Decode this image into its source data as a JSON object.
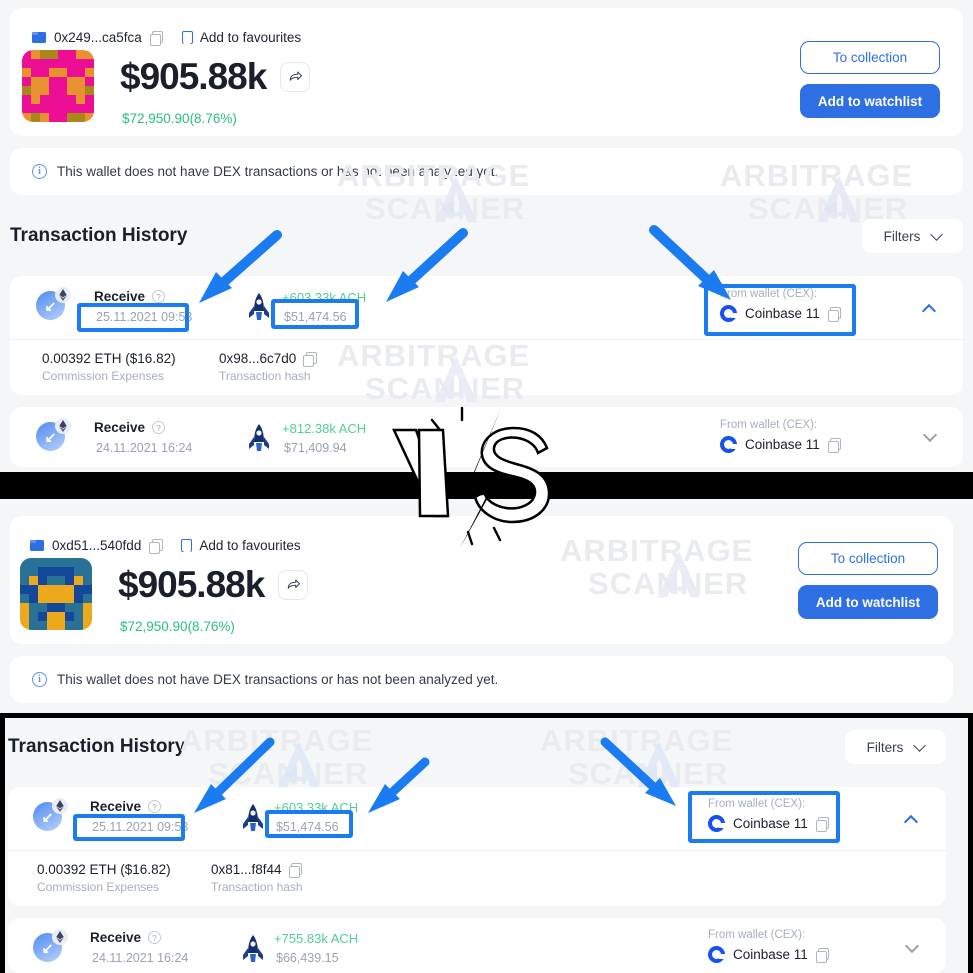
{
  "watermark": {
    "line1": "ARBITRAGE",
    "line2": "SCANNER"
  },
  "panels": [
    {
      "id": "top",
      "address": "0x249...ca5fca",
      "favourites_label": "Add to favourites",
      "balance": "$905.88k",
      "delta": "$72,950.90(8.76%)",
      "to_collection_label": "To collection",
      "watchlist_label": "Add to watchlist",
      "info_text": "This wallet does not have DEX transactions or has not been analyzed yet.",
      "section_title": "Transaction History",
      "filters_label": "Filters",
      "avatar_colors": {
        "bg": "#ec0f96",
        "a": "#e8922f",
        "b": "#a8881a"
      },
      "transactions": [
        {
          "type": "Receive",
          "date": "25.11.2021 09:53",
          "token_amount": "+603.33k ACH",
          "usd_amount": "$51,474.56",
          "wallet_label": "From wallet (CEX):",
          "wallet_name": "Coinbase 11",
          "expanded": true,
          "commission_value": "0.00392 ETH ($16.82)",
          "commission_label": "Commission Expenses",
          "hash_value": "0x98...6c7d0",
          "hash_label": "Transaction hash"
        },
        {
          "type": "Receive",
          "date": "24.11.2021 16:24",
          "token_amount": "+812.38k ACH",
          "usd_amount": "$71,409.94",
          "wallet_label": "From wallet (CEX):",
          "wallet_name": "Coinbase 11",
          "expanded": false
        }
      ]
    },
    {
      "id": "bottom",
      "address": "0xd51...540fdd",
      "favourites_label": "Add to favourites",
      "balance": "$905.88k",
      "delta": "$72,950.90(8.76%)",
      "to_collection_label": "To collection",
      "watchlist_label": "Add to watchlist",
      "info_text": "This wallet does not have DEX transactions or has not been analyzed yet.",
      "section_title": "Transaction History",
      "filters_label": "Filters",
      "avatar_colors": {
        "bg": "#2a7196",
        "a": "#eda91e",
        "b": "#13479a"
      },
      "transactions": [
        {
          "type": "Receive",
          "date": "25.11.2021 09:53",
          "token_amount": "+603.33k ACH",
          "usd_amount": "$51,474.56",
          "wallet_label": "From wallet (CEX):",
          "wallet_name": "Coinbase 11",
          "expanded": true,
          "commission_value": "0.00392 ETH ($16.82)",
          "commission_label": "Commission Expenses",
          "hash_value": "0x81...f8f44",
          "hash_label": "Transaction hash"
        },
        {
          "type": "Receive",
          "date": "24.11.2021 16:24",
          "token_amount": "+755.83k ACH",
          "usd_amount": "$66,439.15",
          "wallet_label": "From wallet (CEX):",
          "wallet_name": "Coinbase 11",
          "expanded": false
        }
      ]
    }
  ],
  "annotation": {
    "vs_label": "VS",
    "arrow_color": "#1a7cf0",
    "highlight_color": "#1a7cf0"
  },
  "colors": {
    "accent": "#2f6fe4",
    "positive": "#53cf92",
    "delta_green": "#28c07d",
    "muted": "#9aa2b1",
    "page_bg": "#f5f6f8"
  }
}
